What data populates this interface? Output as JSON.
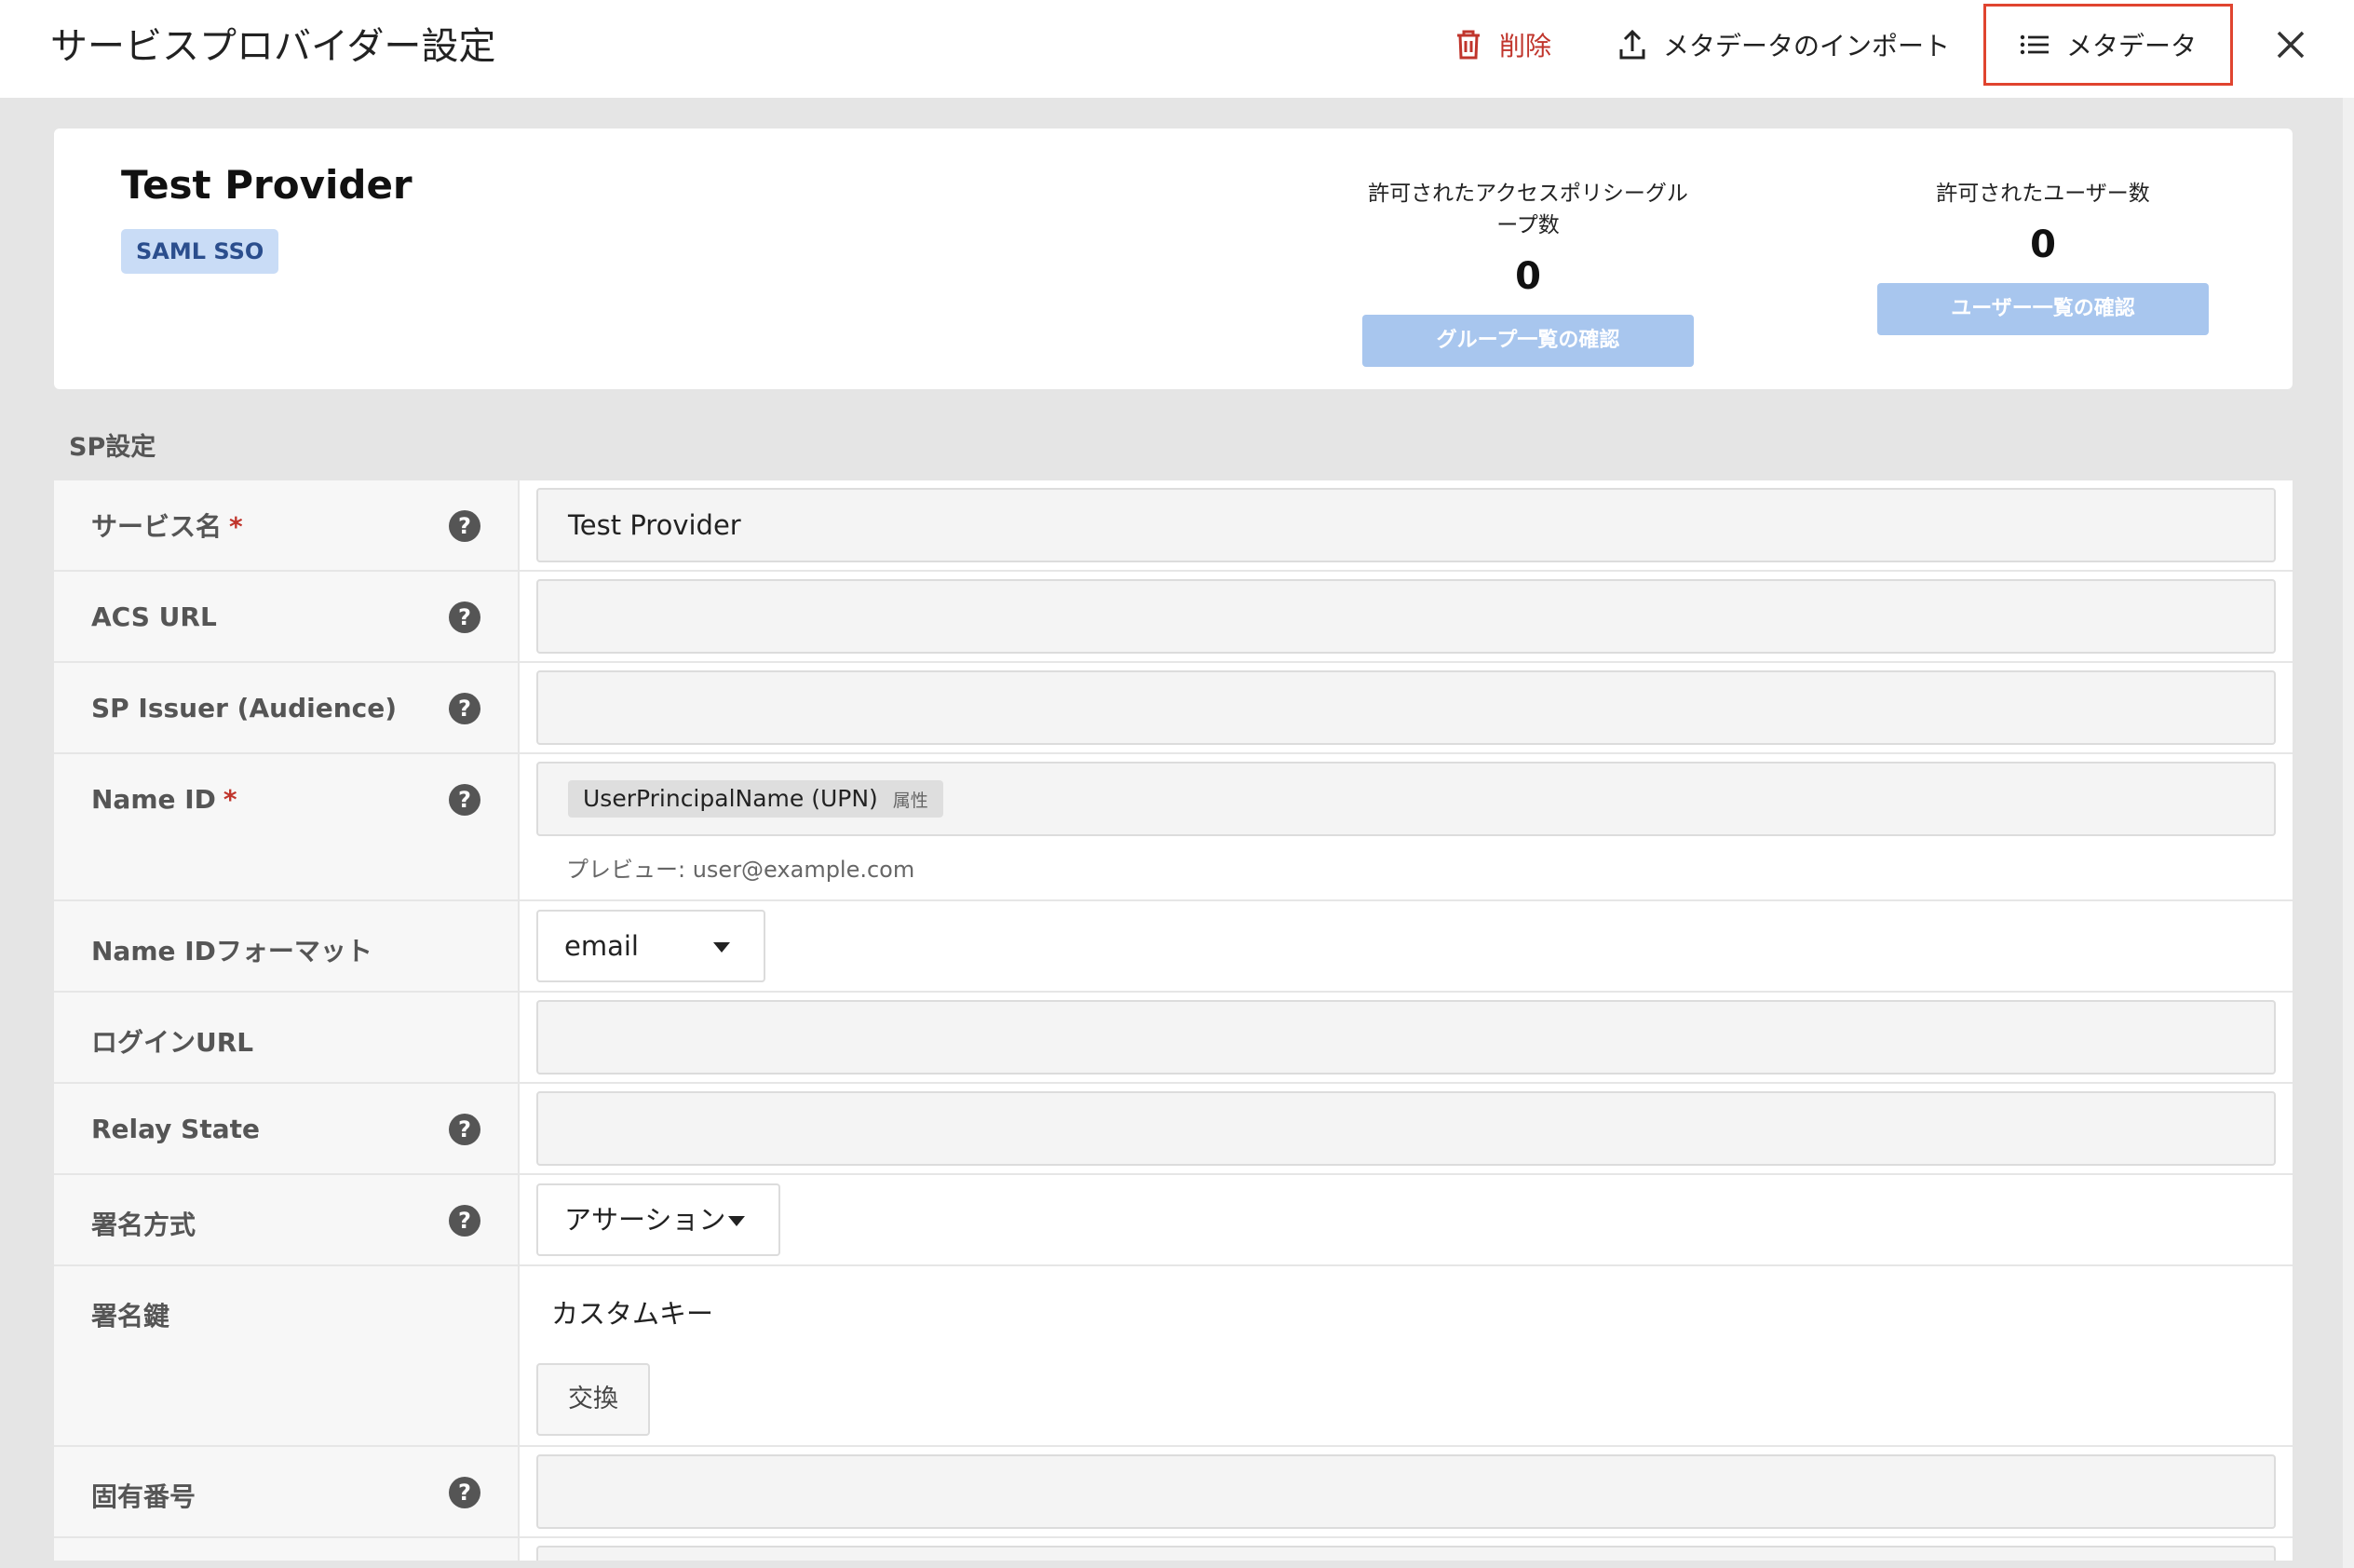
{
  "header": {
    "title": "サービスプロバイダー設定",
    "delete_label": "削除",
    "import_label": "メタデータのインポート",
    "metadata_label": "メタデータ"
  },
  "summary": {
    "title": "Test Provider",
    "badge": "SAML SSO",
    "groups": {
      "label": "許可されたアクセスポリシーグループ数",
      "value": "0",
      "button": "グループ一覧の確認"
    },
    "users": {
      "label": "許可されたユーザー数",
      "value": "0",
      "button": "ユーザー一覧の確認"
    }
  },
  "section_label": "SP設定",
  "form": {
    "service_name": {
      "label": "サービス名",
      "required_mark": "*",
      "value": "Test Provider"
    },
    "acs_url": {
      "label": "ACS URL",
      "value": ""
    },
    "sp_issuer": {
      "label": "SP Issuer (Audience)",
      "value": ""
    },
    "name_id": {
      "label": "Name ID",
      "required_mark": "*",
      "chip": "UserPrincipalName (UPN)",
      "chip_sub": "属性",
      "preview": "プレビュー:  user@example.com"
    },
    "name_id_format": {
      "label": "Name IDフォーマット",
      "value": "email"
    },
    "login_url": {
      "label": "ログインURL",
      "value": ""
    },
    "relay_state": {
      "label": "Relay State",
      "value": ""
    },
    "signature_method": {
      "label": "署名方式",
      "value": "アサーション"
    },
    "signing_key": {
      "label": "署名鍵",
      "value": "カスタムキー",
      "button": "交換"
    },
    "unique_number": {
      "label": "固有番号",
      "value": ""
    }
  },
  "help_glyph": "?",
  "colors": {
    "accent_red": "#c0352c",
    "highlight_border": "#e0442f",
    "badge_bg": "#c9dcf6",
    "button_disabled": "#a8c6ee"
  }
}
